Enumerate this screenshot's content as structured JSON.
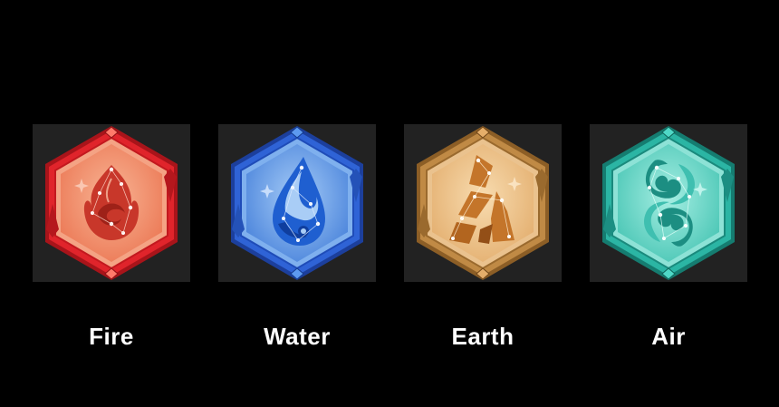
{
  "elements": [
    {
      "id": "fire",
      "label": "Fire",
      "icon": "fire-flame-icon",
      "colors": {
        "rim": "#e0242b",
        "rim_dark": "#a8141a",
        "face": "#f28f6b",
        "face_light": "#f8b595",
        "glyph": "#c8372a",
        "glyph_dark": "#9e2118"
      }
    },
    {
      "id": "water",
      "label": "Water",
      "icon": "water-drop-icon",
      "colors": {
        "rim": "#2f63d6",
        "rim_dark": "#1c3f9c",
        "face": "#5d97e6",
        "face_light": "#8fbaf2",
        "glyph": "#1f5fd0",
        "glyph_dark": "#0f3e9e"
      }
    },
    {
      "id": "earth",
      "label": "Earth",
      "icon": "earth-rock-icon",
      "colors": {
        "rim": "#c08a45",
        "rim_dark": "#8c5e26",
        "face": "#ebbd80",
        "face_light": "#f5d3a2",
        "glyph": "#c4752a",
        "glyph_dark": "#934f17"
      }
    },
    {
      "id": "air",
      "label": "Air",
      "icon": "air-swirl-icon",
      "colors": {
        "rim": "#2bb5a4",
        "rim_dark": "#157c70",
        "face": "#5fd3c3",
        "face_light": "#8fe6da",
        "glyph": "#3fbfb0",
        "glyph_dark": "#1c8e82"
      }
    }
  ]
}
